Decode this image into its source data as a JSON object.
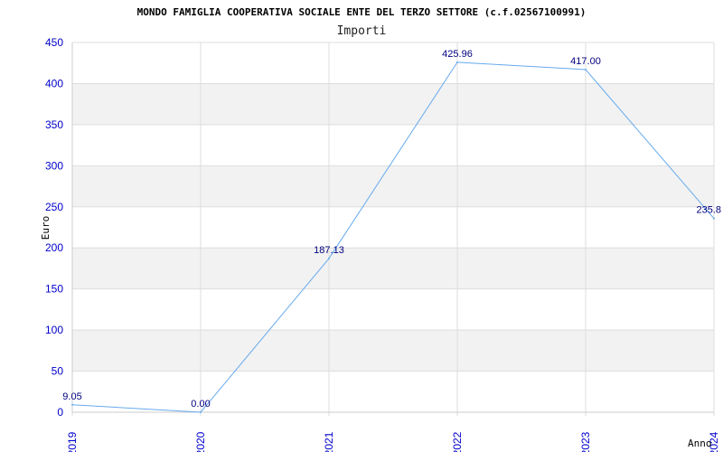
{
  "chart_data": {
    "type": "line",
    "title": "MONDO FAMIGLIA COOPERATIVA SOCIALE ENTE DEL TERZO SETTORE (c.f.02567100991)",
    "subtitle": "Importi",
    "xlabel": "Anno",
    "ylabel": "Euro",
    "categories": [
      "2019",
      "2020",
      "2021",
      "2022",
      "2023",
      "2024"
    ],
    "series": [
      {
        "values": [
          9.05,
          0.0,
          187.13,
          425.96,
          417.0,
          235.8
        ]
      }
    ],
    "data_labels": [
      "9.05",
      "0.00",
      "187.13",
      "425.96",
      "417.00",
      "235.8"
    ],
    "ylim": [
      0,
      450
    ],
    "yticks": [
      0,
      50,
      100,
      150,
      200,
      250,
      300,
      350,
      400,
      450
    ],
    "ytick_labels": [
      "0",
      "50",
      "100",
      "150",
      "200",
      "250",
      "300",
      "350",
      "400",
      "450"
    ],
    "grid": true,
    "colors": {
      "line": "#66aaee",
      "band": "#f2f2f2",
      "grid": "#dddddd",
      "tick_text": "#0000cc",
      "label_text": "#000080"
    }
  }
}
